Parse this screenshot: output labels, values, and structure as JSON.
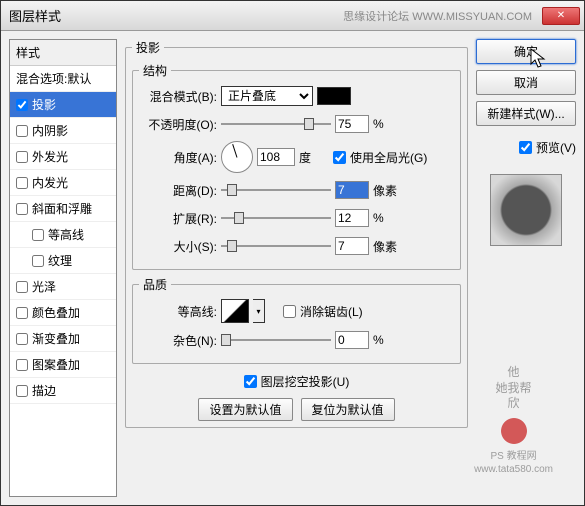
{
  "titlebar": {
    "title": "图层样式",
    "right_text": "思缘设计论坛   WWW.MISSYUAN.COM"
  },
  "left": {
    "header": "样式",
    "items": [
      {
        "label": "混合选项:默认",
        "checked": null
      },
      {
        "label": "投影",
        "checked": true,
        "selected": true
      },
      {
        "label": "内阴影",
        "checked": false
      },
      {
        "label": "外发光",
        "checked": false
      },
      {
        "label": "内发光",
        "checked": false
      },
      {
        "label": "斜面和浮雕",
        "checked": false
      },
      {
        "label": "等高线",
        "checked": false,
        "indent": true
      },
      {
        "label": "纹理",
        "checked": false,
        "indent": true
      },
      {
        "label": "光泽",
        "checked": false
      },
      {
        "label": "颜色叠加",
        "checked": false
      },
      {
        "label": "渐变叠加",
        "checked": false
      },
      {
        "label": "图案叠加",
        "checked": false
      },
      {
        "label": "描边",
        "checked": false
      }
    ]
  },
  "middle": {
    "title": "投影",
    "struct": {
      "legend": "结构",
      "blend_label": "混合模式(B):",
      "blend_value": "正片叠底",
      "opacity_label": "不透明度(O):",
      "opacity_value": "75",
      "opacity_unit": "%",
      "angle_label": "角度(A):",
      "angle_value": "108",
      "angle_unit": "度",
      "global_label": "使用全局光(G)",
      "global_checked": true,
      "distance_label": "距离(D):",
      "distance_value": "7",
      "distance_unit": "像素",
      "spread_label": "扩展(R):",
      "spread_value": "12",
      "spread_unit": "%",
      "size_label": "大小(S):",
      "size_value": "7",
      "size_unit": "像素"
    },
    "quality": {
      "legend": "品质",
      "contour_label": "等高线:",
      "antialias_label": "消除锯齿(L)",
      "antialias_checked": false,
      "noise_label": "杂色(N):",
      "noise_value": "0",
      "noise_unit": "%"
    },
    "knockout_label": "图层挖空投影(U)",
    "knockout_checked": true,
    "btn_default": "设置为默认值",
    "btn_reset": "复位为默认值"
  },
  "right": {
    "ok": "确定",
    "cancel": "取消",
    "new_style": "新建样式(W)...",
    "preview_label": "预览(V)",
    "preview_checked": true
  },
  "watermark": {
    "line1": "他",
    "line2": "她我帮",
    "line3": "欣",
    "ps": "PS 教程网",
    "url": "www.tata580.com"
  }
}
